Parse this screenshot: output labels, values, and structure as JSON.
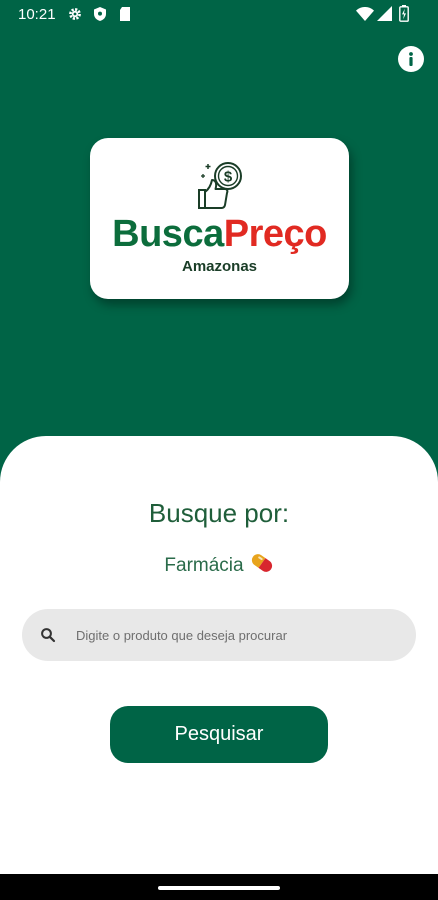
{
  "status_bar": {
    "time": "10:21",
    "icons": [
      "gear-icon",
      "shield-icon",
      "sd-card-icon",
      "wifi-icon",
      "signal-icon",
      "battery-icon"
    ]
  },
  "header": {
    "info_icon": "info-icon"
  },
  "logo": {
    "brand_first": "Busca",
    "brand_second": "Preço",
    "subtitle": "Amazonas",
    "mark_icon": "thumbs-up-coin-icon"
  },
  "main": {
    "heading": "Busque por:",
    "category_label": "Farmácia",
    "category_icon": "pill-icon",
    "search": {
      "placeholder": "Digite o produto que deseja procurar",
      "value": "",
      "icon": "search-icon"
    },
    "submit_label": "Pesquisar"
  },
  "colors": {
    "primary": "#006446",
    "brand_green": "#0c6d3c",
    "brand_red": "#e12a22",
    "search_bg": "#e8e8e8"
  }
}
